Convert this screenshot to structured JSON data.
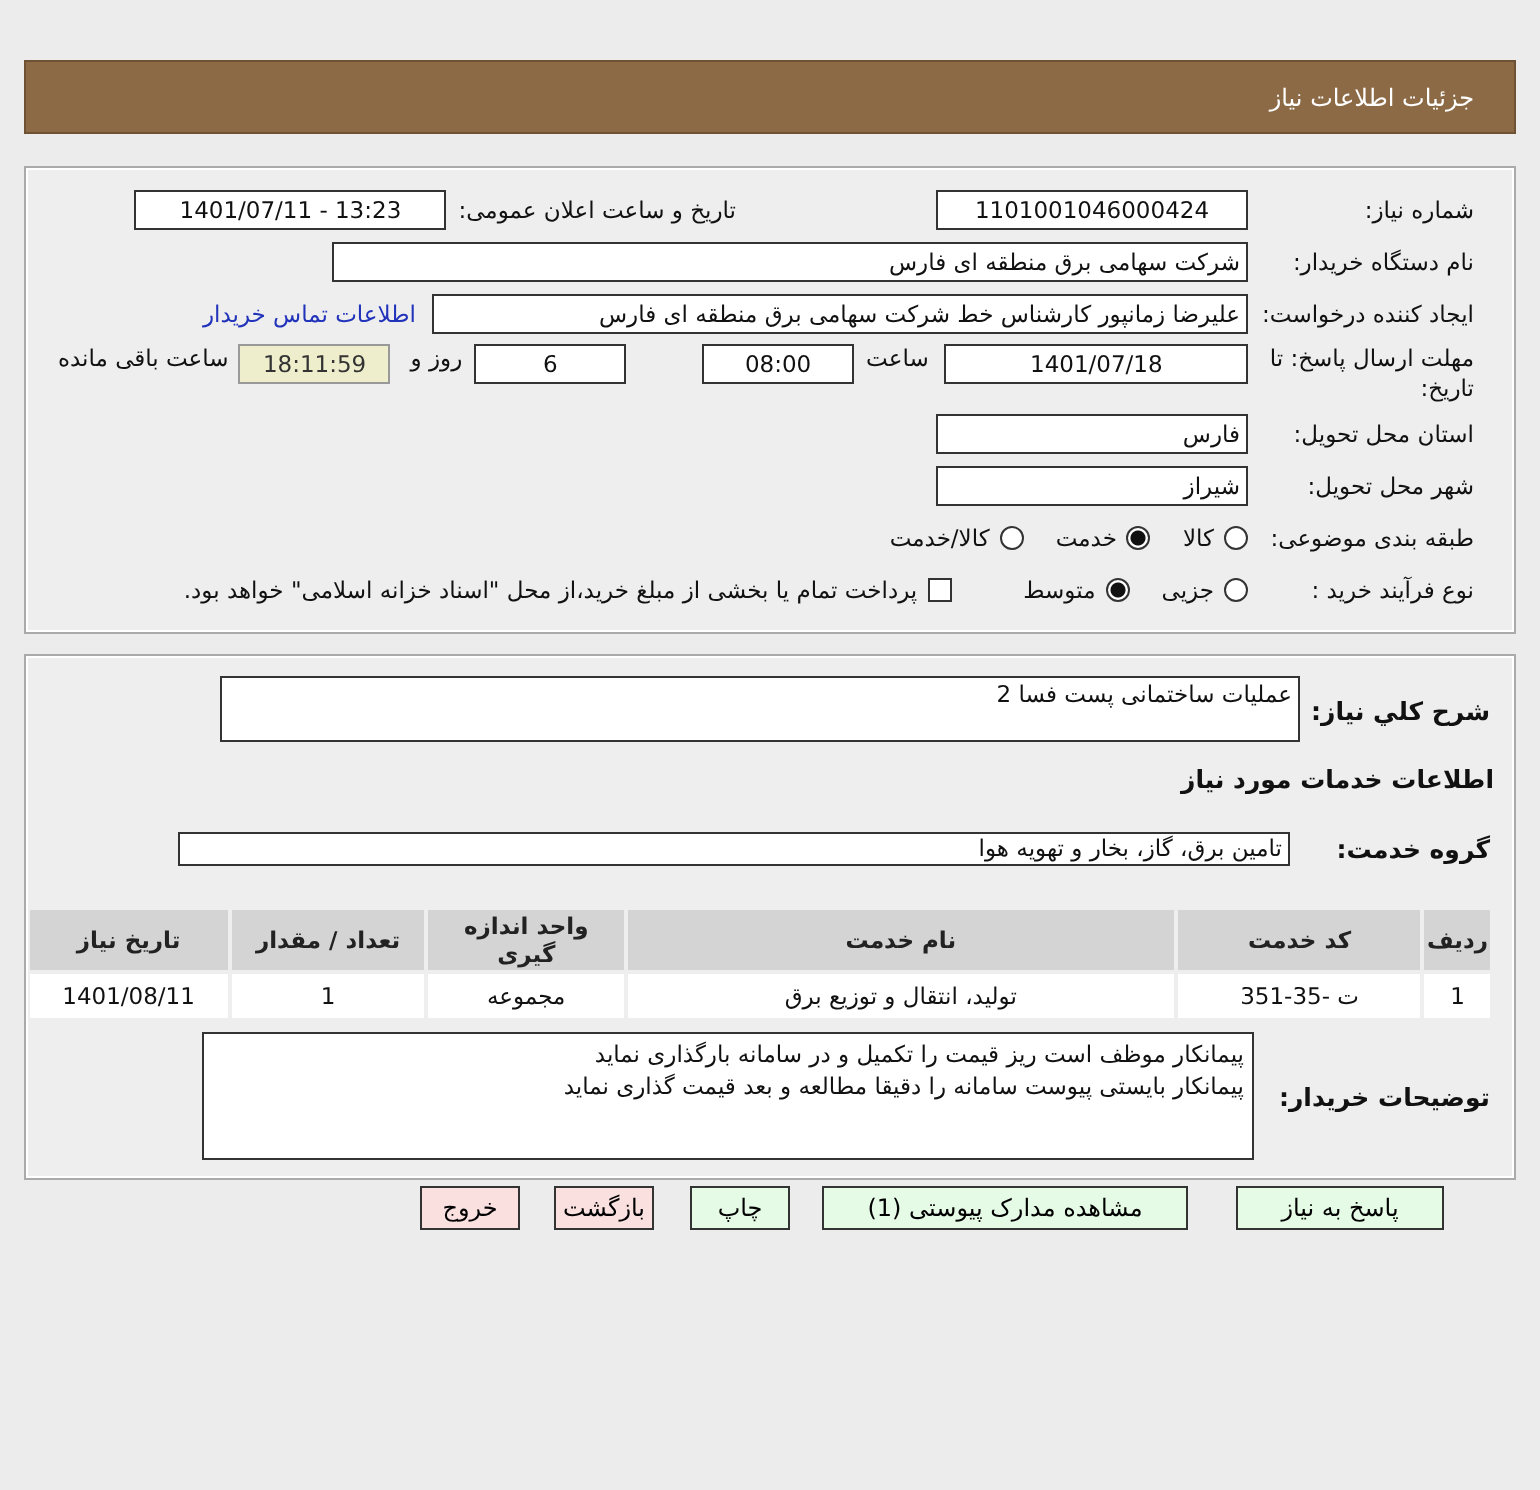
{
  "header": {
    "title": "جزئیات اطلاعات نیاز"
  },
  "need_number": {
    "label": "شماره نیاز:",
    "value": "1101001046000424"
  },
  "announce": {
    "label": "تاریخ و ساعت اعلان عمومی:",
    "value": "1401/07/11 - 13:23"
  },
  "buyer": {
    "label": "نام دستگاه خریدار:",
    "value": "شرکت سهامی برق منطقه ای فارس"
  },
  "requester": {
    "label": "ایجاد کننده درخواست:",
    "value": "علیرضا زمانپور کارشناس خط شرکت سهامی برق منطقه ای فارس",
    "link": "اطلاعات تماس خریدار"
  },
  "deadline": {
    "label": "مهلت ارسال پاسخ: تا تاریخ:",
    "date": "1401/07/18",
    "time_label": "ساعت",
    "time": "08:00",
    "days": "6",
    "days_label": "روز و",
    "remaining": "18:11:59",
    "remaining_label": "ساعت باقی مانده"
  },
  "province": {
    "label": "استان محل تحویل:",
    "value": "فارس"
  },
  "city": {
    "label": "شهر محل تحویل:",
    "value": "شیراز"
  },
  "category": {
    "label": "طبقه بندی موضوعی:",
    "options": [
      {
        "label": "کالا",
        "selected": false
      },
      {
        "label": "خدمت",
        "selected": true
      },
      {
        "label": "کالا/خدمت",
        "selected": false
      }
    ]
  },
  "process": {
    "label": "نوع فرآیند خرید :",
    "options": [
      {
        "label": "جزیی",
        "selected": false
      },
      {
        "label": "متوسط",
        "selected": true
      }
    ],
    "checkbox": {
      "label": "پرداخت تمام یا بخشی از مبلغ خرید،از محل \"اسناد خزانه اسلامی\" خواهد بود.",
      "checked": false
    }
  },
  "summary": {
    "label": "شرح كلي نياز:",
    "value": "عملیات ساختمانی پست فسا 2"
  },
  "services_title": "اطلاعات خدمات مورد نیاز",
  "service_group": {
    "label": "گروه خدمت:",
    "value": "تامین برق، گاز، بخار و تهویه هوا"
  },
  "table": {
    "columns": [
      "ردیف",
      "کد خدمت",
      "نام خدمت",
      "واحد اندازه گیری",
      "تعداد / مقدار",
      "تاریخ نیاز"
    ],
    "rows": [
      [
        "1",
        "ت -35-351",
        "تولید، انتقال و توزیع برق",
        "مجموعه",
        "1",
        "1401/08/11"
      ]
    ]
  },
  "buyer_notes": {
    "label": "توضیحات خریدار:",
    "lines": [
      "پیمانکار موظف است ریز قیمت را تکمیل و در سامانه بارگذاری نماید",
      "پیمانکار بایستی پیوست سامانه را دقیقا مطالعه و بعد قیمت گذاری نماید"
    ]
  },
  "buttons": [
    {
      "label": "پاسخ به نیاز",
      "kind": "normal"
    },
    {
      "label": "مشاهده مدارک پیوستی (1)",
      "kind": "normal"
    },
    {
      "label": "چاپ",
      "kind": "normal"
    },
    {
      "label": "بازگشت",
      "kind": "danger"
    },
    {
      "label": "خروج",
      "kind": "danger"
    }
  ]
}
